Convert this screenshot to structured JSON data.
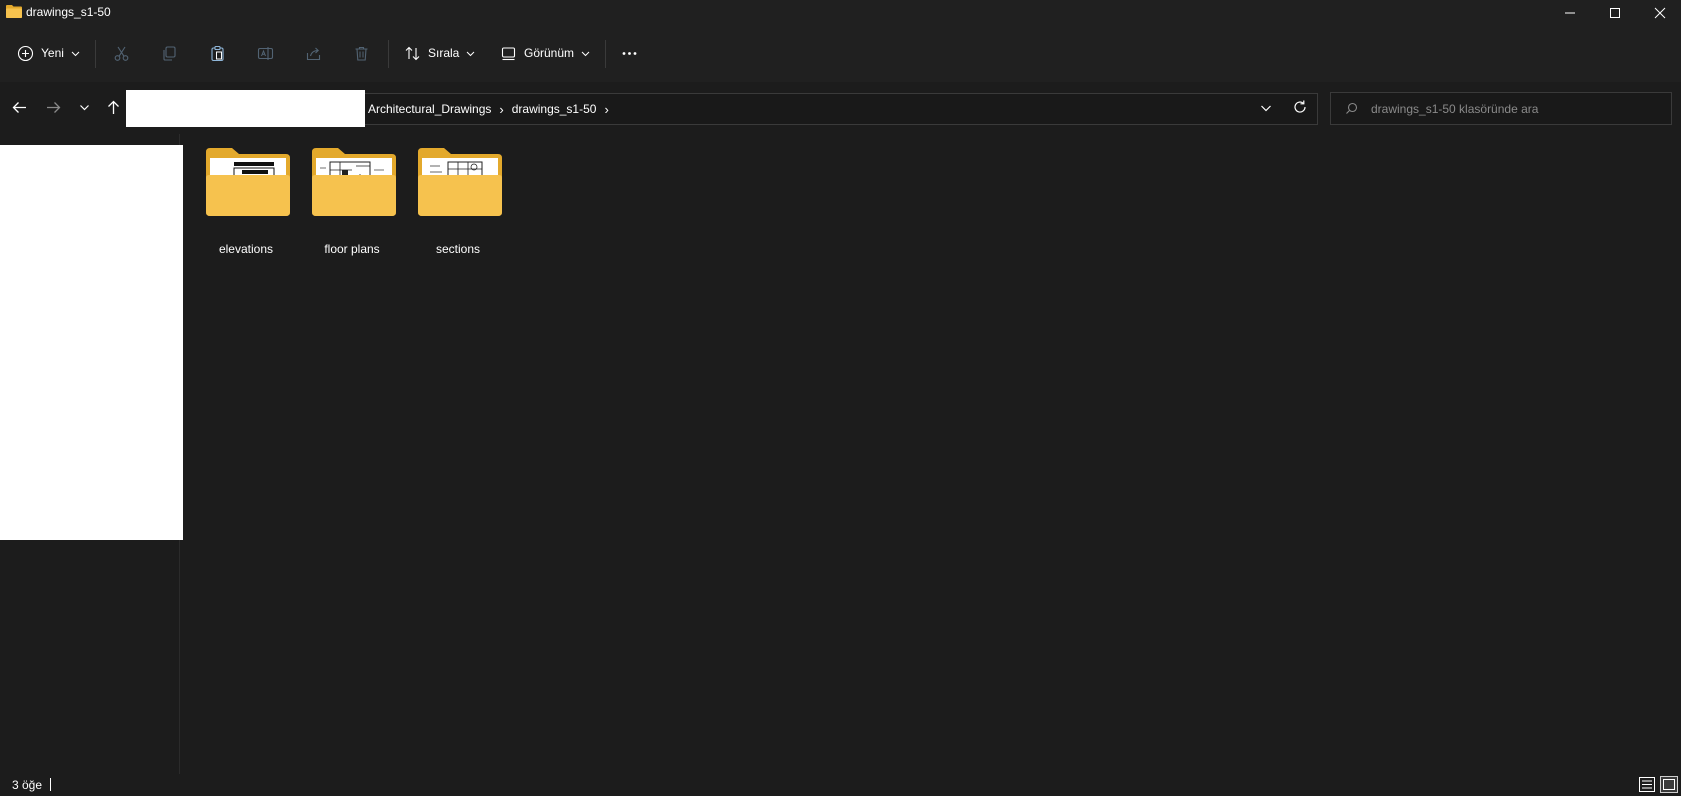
{
  "window": {
    "title": "drawings_s1-50"
  },
  "toolbar": {
    "new_label": "Yeni",
    "sort_label": "Sırala",
    "view_label": "Görünüm"
  },
  "address": {
    "crumbs": [
      "Architectural_Drawings",
      "drawings_s1-50"
    ]
  },
  "search": {
    "placeholder": "drawings_s1-50 klasöründe ara"
  },
  "folders": [
    {
      "name": "elevations"
    },
    {
      "name": "floor plans"
    },
    {
      "name": "sections"
    }
  ],
  "status": {
    "item_count": "3 öğe"
  },
  "colors": {
    "background": "#1c1c1c",
    "chrome": "#202020",
    "folder": "#f6c24e",
    "folder_dark": "#e3a92c"
  }
}
